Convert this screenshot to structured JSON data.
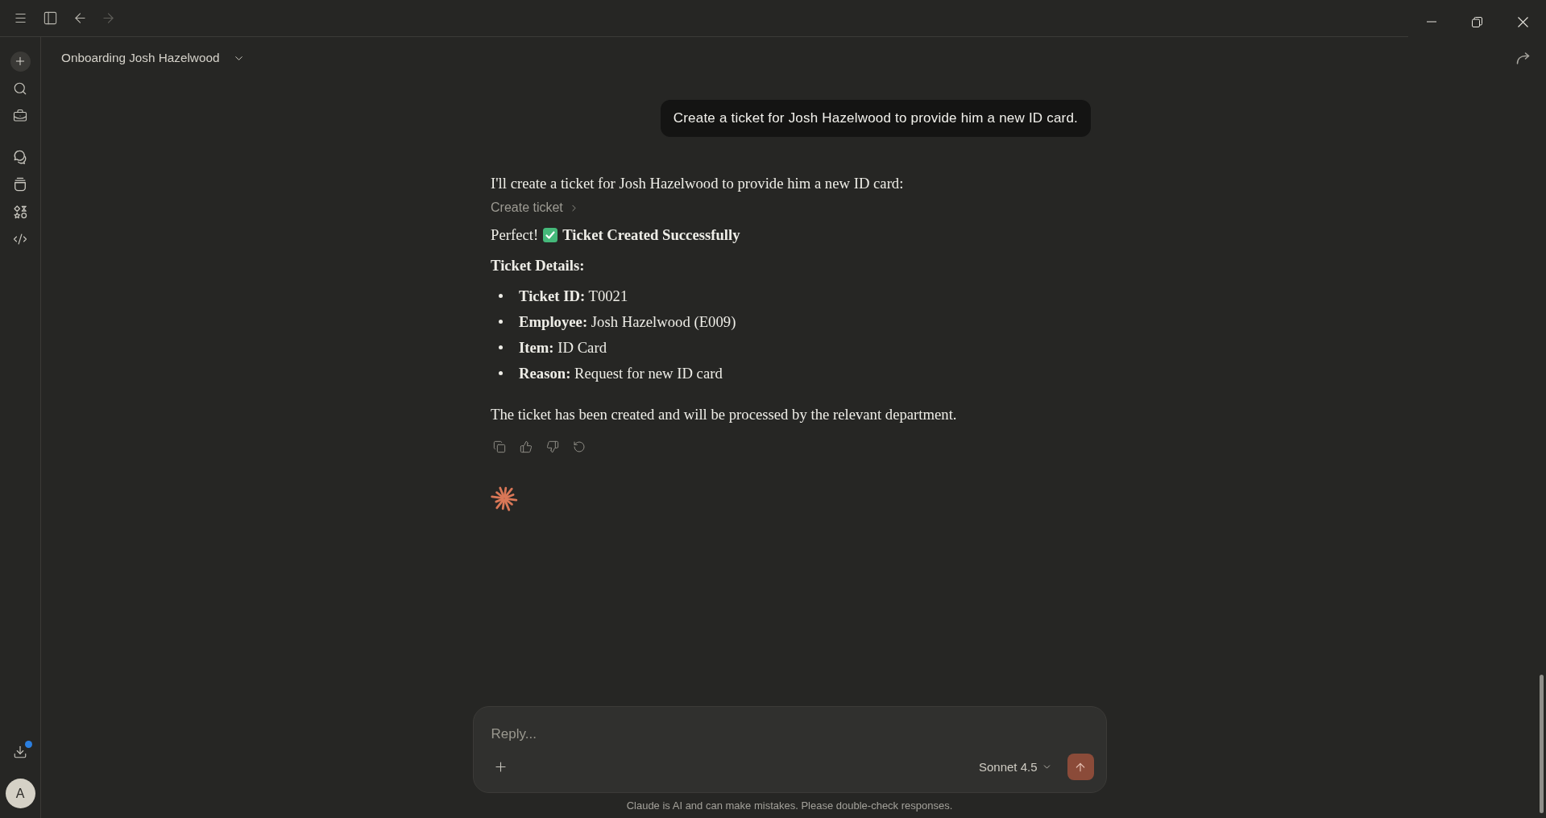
{
  "nav": {
    "back": {
      "disabled": false
    },
    "forward": {
      "disabled": true
    }
  },
  "sidebar": {
    "downloads": {
      "notification": true
    },
    "account": {
      "initial": "A"
    }
  },
  "conversation": {
    "title": "Onboarding Josh Hazelwood"
  },
  "messages": [
    {
      "kind": "user",
      "text": "Create a ticket for Josh Hazelwood to provide him a new ID card."
    },
    {
      "kind": "assistant",
      "blocks": [
        {
          "kind": "paragraph",
          "text": "I'll create a ticket for Josh Hazelwood to provide him a new ID card:"
        },
        {
          "kind": "tool",
          "label": "Create ticket",
          "expanded": false
        },
        {
          "kind": "status",
          "lead": "Perfect!",
          "title": "Ticket Created Successfully"
        },
        {
          "kind": "heading",
          "text": "Ticket Details:"
        },
        {
          "kind": "list",
          "items": [
            "**Ticket ID:** T0021",
            "**Employee:** Josh Hazelwood (E009)",
            "**Item:** ID Card",
            "**Reason:** Request for new ID card"
          ]
        },
        {
          "kind": "paragraph",
          "text": "The ticket has been created and will be processed by the relevant department."
        }
      ]
    }
  ],
  "composer": {
    "placeholder": "Reply...",
    "model": "Sonnet 4.5",
    "send": {
      "disabled": true
    }
  },
  "disclaimer": "Claude is AI and can make mistakes. Please double-check responses."
}
